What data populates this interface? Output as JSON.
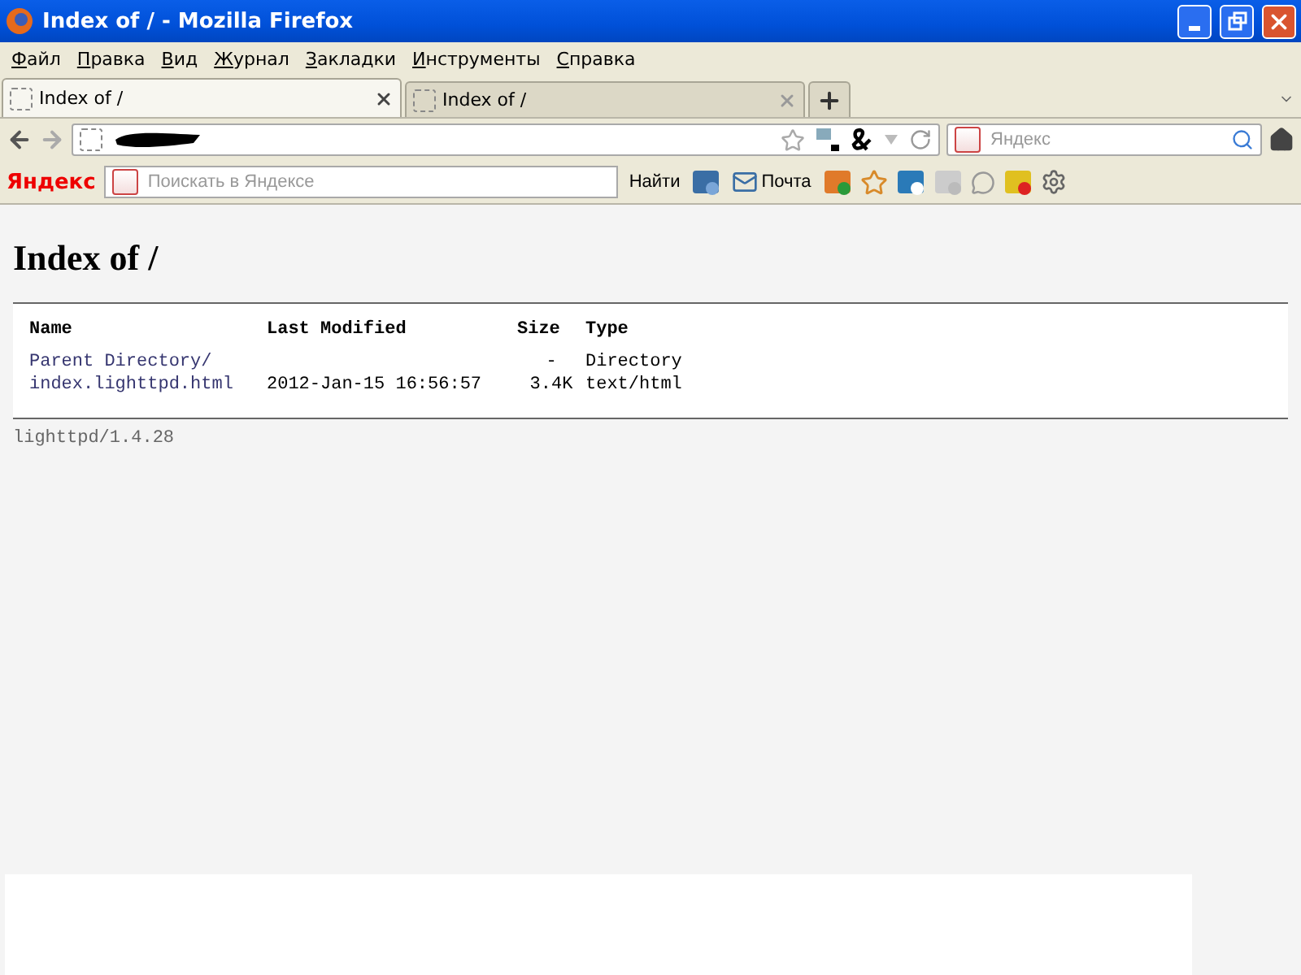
{
  "window": {
    "title": "Index of / - Mozilla Firefox"
  },
  "menu": [
    "Файл",
    "Правка",
    "Вид",
    "Журнал",
    "Закладки",
    "Инструменты",
    "Справка"
  ],
  "tabs": [
    {
      "label": "Index of /",
      "selected": true
    },
    {
      "label": "Index of /",
      "selected": false
    }
  ],
  "search_bar": {
    "placeholder": "Яндекс"
  },
  "yandex_bar": {
    "logo": "Яндекс",
    "placeholder": "Поискать в Яндексе",
    "find": "Найти",
    "mail": "Почта"
  },
  "page": {
    "heading": "Index of /",
    "columns": [
      "Name",
      "Last Modified",
      "Size",
      "Type"
    ],
    "rows": [
      {
        "name": "Parent Directory/",
        "modified": "",
        "size": "-",
        "type": "Directory"
      },
      {
        "name": "index.lighttpd.html",
        "modified": "2012-Jan-15 16:56:57",
        "size": "3.4K",
        "type": "text/html"
      }
    ],
    "footer": "lighttpd/1.4.28"
  }
}
